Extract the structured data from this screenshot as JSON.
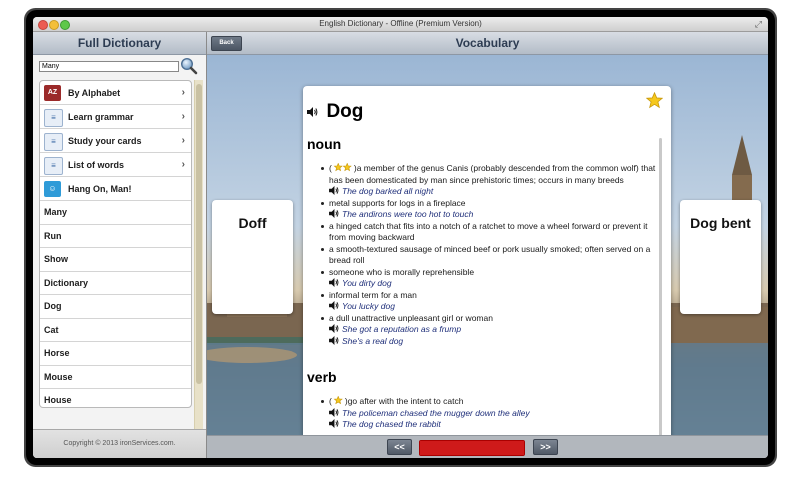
{
  "window": {
    "title": "English Dictionary - Offline (Premium Version)"
  },
  "sidebar": {
    "title": "Full Dictionary",
    "search": {
      "value": "Many"
    },
    "menu": [
      {
        "label": "By Alphabet",
        "icon": "az-icon",
        "color": "#9b2a2a"
      },
      {
        "label": "Learn grammar",
        "icon": "grammar-book-icon",
        "color": "#3b6aa5"
      },
      {
        "label": "Study your cards",
        "icon": "cards-icon",
        "color": "#3b6aa5"
      },
      {
        "label": "List of words",
        "icon": "list-icon",
        "color": "#3b6aa5"
      },
      {
        "label": "Hang On, Man!",
        "icon": "hangman-icon",
        "color": "#2f9bd8"
      }
    ],
    "words": [
      "Many",
      "Run",
      "Show",
      "Dictionary",
      "Dog",
      "Cat",
      "Horse",
      "Mouse",
      "House"
    ],
    "footer": "Copyright © 2013 ironServices.com."
  },
  "main": {
    "back_label": "Back",
    "title": "Vocabulary",
    "prev_word": "Doff",
    "next_word": "Dog bent",
    "prev_label": "<<",
    "next_label": ">>",
    "progress": 1.0,
    "accent": "#cf1a1a"
  },
  "entry": {
    "word": "Dog",
    "favorite": true,
    "noun": {
      "label": "noun",
      "definitions": [
        {
          "text": "a member of the genus Canis (probably descended from the common wolf) that has been domesticated by man since prehistoric times; occurs in many breeds",
          "stars": 2,
          "examples": [
            "The dog barked all night"
          ]
        },
        {
          "text": "metal supports for logs in a fireplace",
          "examples": [
            "The andirons were too hot to touch"
          ]
        },
        {
          "text": "a hinged catch that fits into a notch of a ratchet to move a wheel forward or prevent it from moving backward",
          "examples": []
        },
        {
          "text": "a smooth-textured sausage of minced beef or pork usually smoked; often served on a bread roll",
          "examples": []
        },
        {
          "text": "someone who is morally reprehensible",
          "examples": [
            "You dirty dog"
          ]
        },
        {
          "text": "informal term for a man",
          "examples": [
            "You lucky dog"
          ]
        },
        {
          "text": "a dull unattractive unpleasant girl or woman",
          "examples": [
            "She got a reputation as a frump",
            "She's a real dog"
          ]
        }
      ]
    },
    "verb": {
      "label": "verb",
      "definitions": [
        {
          "text": "go after with the intent to catch",
          "stars": 1,
          "examples": [
            "The policeman chased the mugger down the alley",
            "The dog chased the rabbit"
          ]
        }
      ]
    }
  }
}
